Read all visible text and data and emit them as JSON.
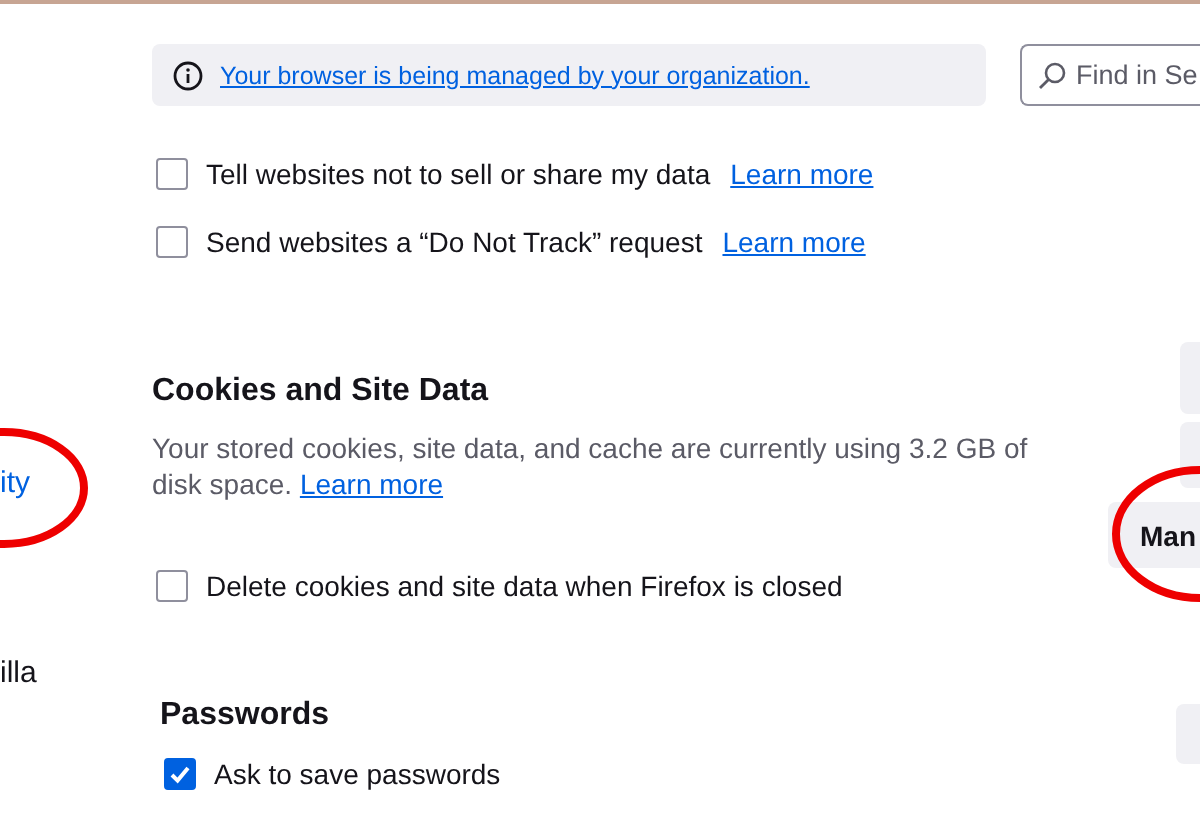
{
  "sidebar": {
    "items": [
      {
        "label": "ity",
        "selected": true
      },
      {
        "label": "illa",
        "selected": false
      }
    ]
  },
  "notice": {
    "text": "Your browser is being managed by your organization."
  },
  "search": {
    "placeholder": "Find in Se"
  },
  "tracking_options": [
    {
      "label": "Tell websites not to sell or share my data",
      "checked": false,
      "link": "Learn more"
    },
    {
      "label": "Send websites a “Do Not Track” request",
      "checked": false,
      "link": "Learn more"
    }
  ],
  "cookies": {
    "heading": "Cookies and Site Data",
    "description": "Your stored cookies, site data, and cache are currently using 3.2 GB of disk space.",
    "link": "Learn more",
    "option": {
      "label": "Delete cookies and site data when Firefox is closed",
      "checked": false
    },
    "buttons": [
      "Man"
    ]
  },
  "passwords": {
    "heading": "Passwords",
    "option": {
      "label": "Ask to save passwords",
      "checked": true
    }
  }
}
